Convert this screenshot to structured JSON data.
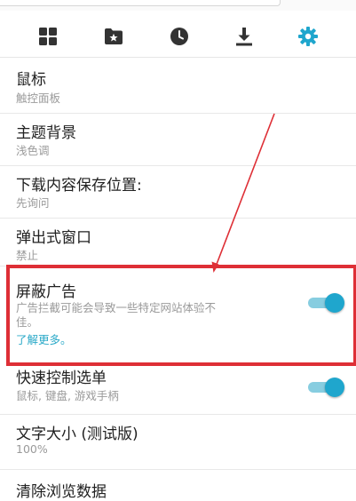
{
  "toolbar": {
    "items": [
      {
        "name": "dashboard",
        "icon": "grid-icon",
        "active": false
      },
      {
        "name": "bookmarks",
        "icon": "folder-star-icon",
        "active": false
      },
      {
        "name": "history",
        "icon": "clock-icon",
        "active": false
      },
      {
        "name": "downloads",
        "icon": "download-icon",
        "active": false
      },
      {
        "name": "settings",
        "icon": "gear-icon",
        "active": true
      }
    ],
    "active_color": "#1fa6cd",
    "inactive_color": "#333333"
  },
  "settings": {
    "mouse": {
      "title": "鼠标",
      "subtitle": "触控面板"
    },
    "theme": {
      "title": "主题背景",
      "subtitle": "浅色调"
    },
    "download_location": {
      "title": "下载内容保存位置:",
      "subtitle": "先询问"
    },
    "popups": {
      "title": "弹出式窗口",
      "subtitle": "禁止"
    },
    "block_ads": {
      "title": "屏蔽广告",
      "desc_line1": "广告拦截可能会导致一些特定网站体验不",
      "desc_line2": "佳。",
      "link": "了解更多。",
      "enabled": true
    },
    "quick_controls": {
      "title": "快速控制选单",
      "subtitle": "鼠标, 键盘, 游戏手柄",
      "enabled": true
    },
    "text_size": {
      "title": "文字大小 (测试版)",
      "subtitle": "100%"
    },
    "clear_data": {
      "title": "清除浏览数据"
    }
  },
  "annotation": {
    "color": "#de2f36"
  }
}
